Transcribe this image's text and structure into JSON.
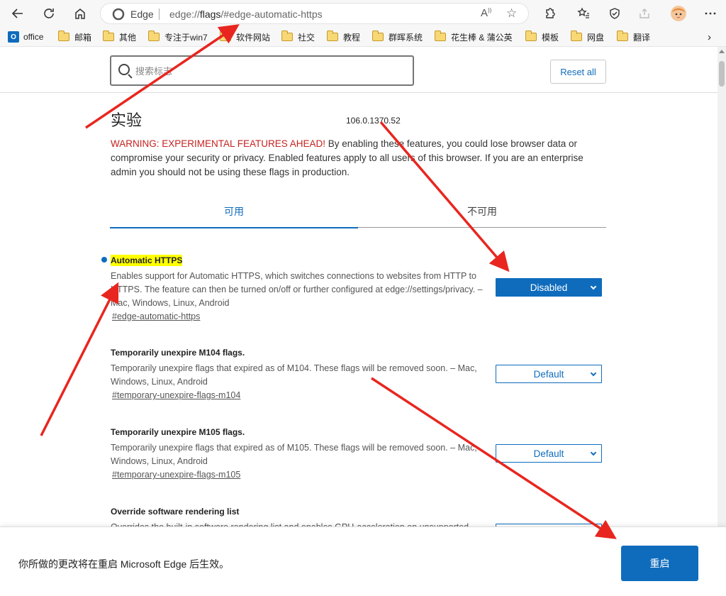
{
  "browser": {
    "address": {
      "site_name": "Edge",
      "url_prefix": "edge://",
      "url_bold": "flags",
      "url_suffix": "/#edge-automatic-https"
    },
    "bookmarks": [
      "office",
      "邮箱",
      "其他",
      "专注于win7",
      "软件网站",
      "社交",
      "教程",
      "群晖系统",
      "花生棒 & 蒲公英",
      "模板",
      "网盘",
      "翻译"
    ]
  },
  "flags_page": {
    "search_placeholder": "搜索标志",
    "reset_label": "Reset all",
    "title": "实验",
    "version": "106.0.1370.52",
    "warning_label": "WARNING: EXPERIMENTAL FEATURES AHEAD!",
    "warning_text": " By enabling these features, you could lose browser data or compromise your security or privacy. Enabled features apply to all users of this browser. If you are an enterprise admin you should not be using these flags in production.",
    "tabs": {
      "available": "可用",
      "unavailable": "不可用"
    },
    "flags": [
      {
        "title": "Automatic HTTPS",
        "description": "Enables support for Automatic HTTPS, which switches connections to websites from HTTP to HTTPS. The feature can then be turned on/off or further configured at edge://settings/privacy. – Mac, Windows, Linux, Android",
        "link": "#edge-automatic-https",
        "value": "Disabled"
      },
      {
        "title": "Temporarily unexpire M104 flags.",
        "description": "Temporarily unexpire flags that expired as of M104. These flags will be removed soon. – Mac, Windows, Linux, Android",
        "link": "#temporary-unexpire-flags-m104",
        "value": "Default"
      },
      {
        "title": "Temporarily unexpire M105 flags.",
        "description": "Temporarily unexpire flags that expired as of M105. These flags will be removed soon. – Mac, Windows, Linux, Android",
        "link": "#temporary-unexpire-flags-m105",
        "value": "Default"
      },
      {
        "title": "Override software rendering list",
        "description": "Overrides the built-in software rendering list and enables GPU-acceleration on unsupported",
        "link": "",
        "value": ""
      }
    ]
  },
  "footer": {
    "message": "你所做的更改将在重启 Microsoft Edge 后生效。",
    "restart_label": "重启"
  },
  "colors": {
    "accent": "#0f6cbd",
    "warning": "#c5221f",
    "highlight": "#ffff00",
    "annotation": "#e8261f"
  }
}
